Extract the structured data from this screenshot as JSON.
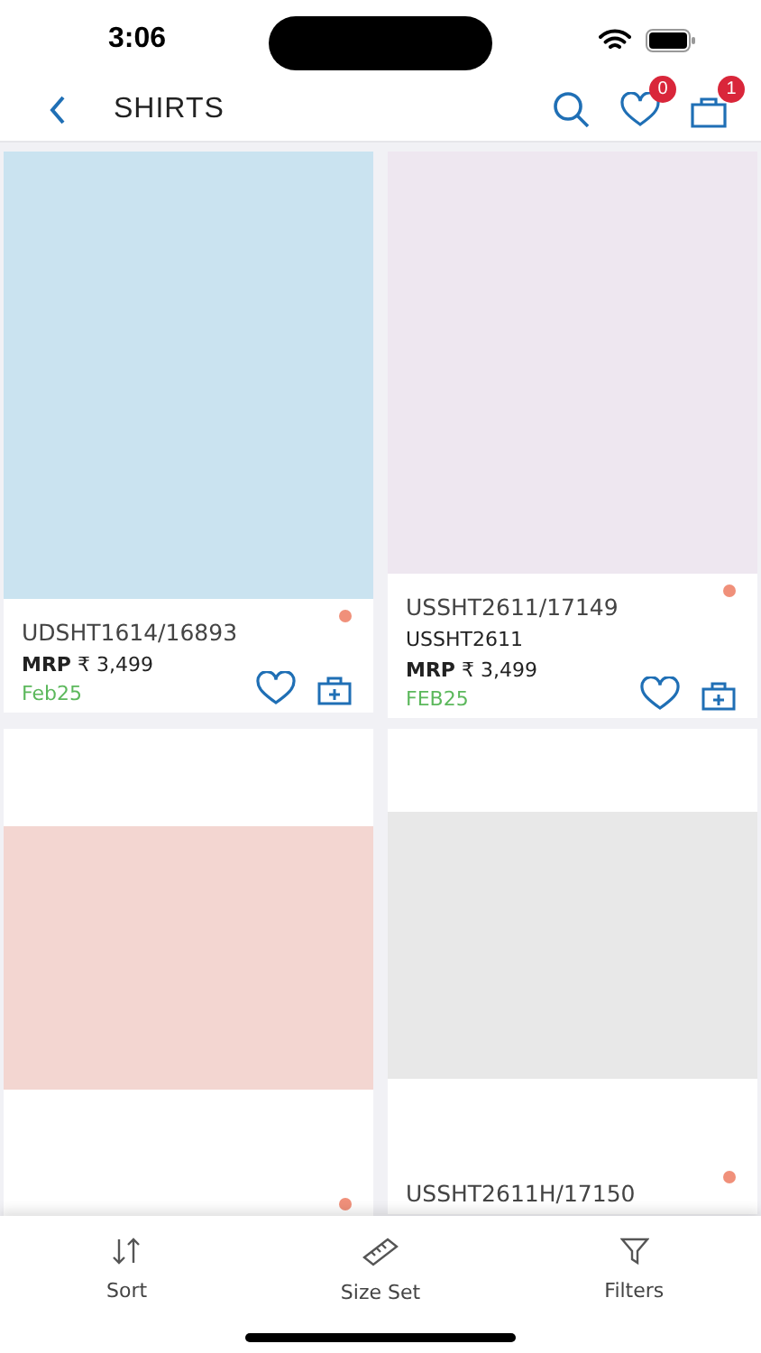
{
  "status_bar": {
    "time": "3:06"
  },
  "header": {
    "title": "SHIRTS",
    "wishlist_count": "0",
    "bag_count": "1"
  },
  "products": [
    {
      "code": "UDSHT1614/16893",
      "image": {
        "color": "#cae3f0"
      },
      "color": "#f0907a",
      "price_label": "MRP",
      "price": "₹ 3,499",
      "season": "Feb25"
    },
    {
      "code": "USSHT2611/17149",
      "style": "USSHT2611",
      "image": {
        "color": "#eee7f0"
      },
      "color": "#f0907a",
      "price_label": "MRP",
      "price": "₹ 3,499",
      "season": "FEB25"
    },
    {
      "image": {
        "color": "#f3d6d1"
      },
      "color": "#f0907a"
    },
    {
      "code": "USSHT2611H/17150",
      "image": {
        "color": "#e8e8e8"
      },
      "color": "#f0907a"
    }
  ],
  "bottom_bar": [
    {
      "kind": "sort",
      "label": "Sort"
    },
    {
      "kind": "size",
      "label": "Size Set"
    },
    {
      "kind": "filter",
      "label": "Filters"
    }
  ]
}
